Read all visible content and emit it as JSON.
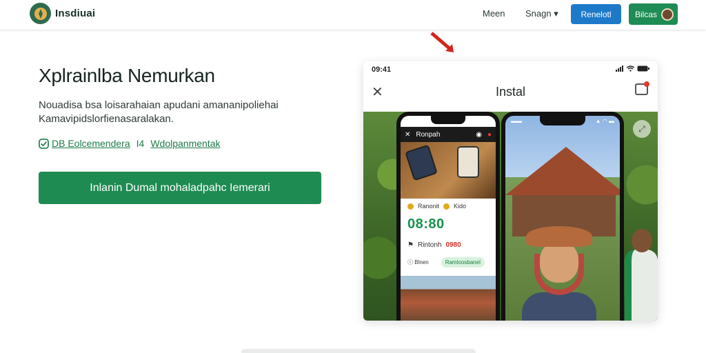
{
  "nav": {
    "brand": "Insdiuai",
    "link1": "Meen",
    "link2": "Snagn",
    "button_blue": "Renelotl",
    "button_green": "Bilcas"
  },
  "hero": {
    "title": "Xplrainlba Nemurkan",
    "subtitle": "Nouadisa bsa loisarahaian apudani amananipoliehai Kamavipidslorfienasaralakan.",
    "link1": "DB Eolcemendera",
    "separator": "I4",
    "link2": "Wdolpanmentak",
    "cta": "Inlanin Dumal mohaladpahc Iemerari"
  },
  "card": {
    "time": "09:41",
    "title": "Instal",
    "phone1": {
      "header": "Ronpah",
      "row1_a": "Ranonit",
      "row1_b": "Kido",
      "big_value": "08:80",
      "row2_label": "Rintonh",
      "row2_value": "0980",
      "row3_label": "Blnen",
      "pill": "Ramloosbanel"
    }
  },
  "colors": {
    "primary_green": "#1e8b52",
    "primary_blue": "#1e7ac9",
    "accent_red": "#e03a2e"
  }
}
